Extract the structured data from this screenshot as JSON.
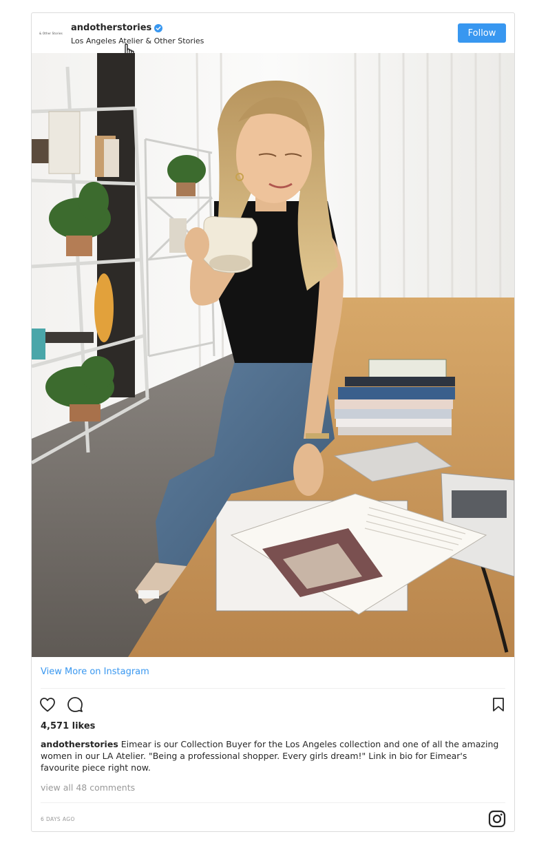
{
  "post": {
    "avatar_text": "& Other Stories",
    "username": "andotherstories",
    "location": "Los Angeles Atelier & Other Stories",
    "follow_label": "Follow",
    "view_more": "View More on Instagram",
    "likes": "4,571 likes",
    "caption_user": "andotherstories",
    "caption_text": " Eimear is our Collection Buyer for the Los Angeles collection and one of all the amazing women in our LA Atelier. \"Being a professional shopper. Every girls dream!\" Link in bio for Eimear's favourite piece right now.",
    "comments_link": "view all 48 comments",
    "timestamp": "6 DAYS AGO"
  },
  "icons": {
    "verified": "verified-badge-icon",
    "like": "heart-icon",
    "comment": "comment-icon",
    "save": "bookmark-icon",
    "instagram": "instagram-logo-icon",
    "cursor": "hand-pointer-cursor"
  },
  "colors": {
    "accent": "#3897f0",
    "text": "#262626",
    "muted": "#999999",
    "border": "#dbdbdb"
  }
}
